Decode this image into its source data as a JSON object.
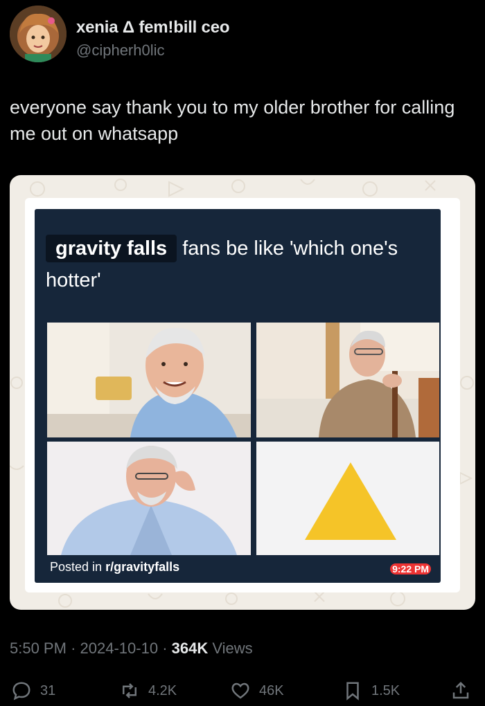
{
  "author": {
    "display_name": "xenia Δ fem!bill ceo",
    "handle": "@cipherh0lic",
    "avatar_icon": "avatar-illustration"
  },
  "tweet": {
    "text": "everyone say thank you to my older brother for calling me out on whatsapp"
  },
  "media": {
    "meme_caption_highlight": "gravity falls",
    "meme_caption_rest": " fans be like 'which one's hotter'",
    "posted_prefix": "Posted in ",
    "posted_subreddit": "r/gravityfalls",
    "chat_time": "9:22 PM",
    "tiles": [
      "harold-smiling-photo",
      "man-with-cane-photo",
      "harold-headache-photo",
      "yellow-triangle"
    ]
  },
  "meta": {
    "time": "5:50 PM",
    "sep": "·",
    "date": "2024-10-10",
    "views_count": "364K",
    "views_label": "Views"
  },
  "actions": {
    "replies": "31",
    "reposts": "4.2K",
    "likes": "46K",
    "bookmarks": "1.5K"
  },
  "colors": {
    "background": "#000000",
    "text": "#e7e9ea",
    "muted": "#71767b",
    "meme_bg": "#16263a",
    "triangle": "#f5c428"
  }
}
